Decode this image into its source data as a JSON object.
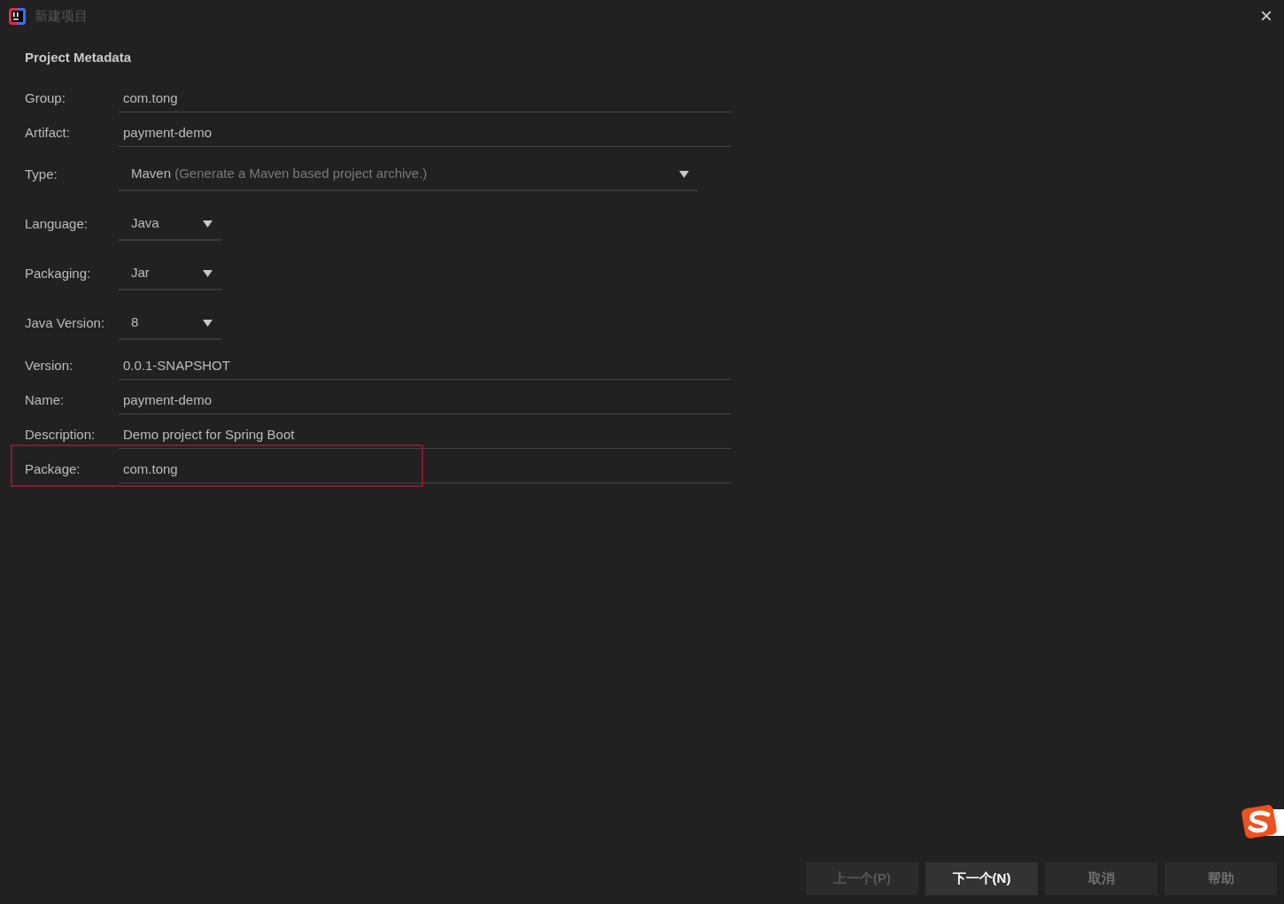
{
  "window": {
    "title": "新建项目",
    "close": "×"
  },
  "section_title": "Project Metadata",
  "fields": [
    {
      "kind": "text",
      "label": "Group:",
      "value": "com.tong",
      "highlighted": false
    },
    {
      "kind": "text",
      "label": "Artifact:",
      "value": "payment-demo",
      "highlighted": false
    },
    {
      "kind": "select",
      "label": "Type:",
      "value": "Maven",
      "description": "(Generate a Maven based project archive.)",
      "highlighted": false
    },
    {
      "kind": "select",
      "label": "Language:",
      "value": "Java",
      "highlighted": false
    },
    {
      "kind": "select",
      "label": "Packaging:",
      "value": "Jar",
      "highlighted": false
    },
    {
      "kind": "select",
      "label": "Java Version:",
      "value": "8",
      "highlighted": false
    },
    {
      "kind": "text",
      "label": "Version:",
      "value": "0.0.1-SNAPSHOT",
      "highlighted": false
    },
    {
      "kind": "text",
      "label": "Name:",
      "value": "payment-demo",
      "highlighted": false
    },
    {
      "kind": "text",
      "label": "Description:",
      "value": "Demo project for Spring Boot",
      "highlighted": false
    },
    {
      "kind": "text",
      "label": "Package:",
      "value": "com.tong",
      "highlighted": true
    }
  ],
  "buttons": [
    {
      "label": "上一个(P)",
      "disabled": true,
      "primary": false
    },
    {
      "label": "下一个(N)",
      "disabled": false,
      "primary": true
    },
    {
      "label": "取消",
      "disabled": false,
      "primary": false
    },
    {
      "label": "帮助",
      "disabled": false,
      "primary": false
    }
  ]
}
